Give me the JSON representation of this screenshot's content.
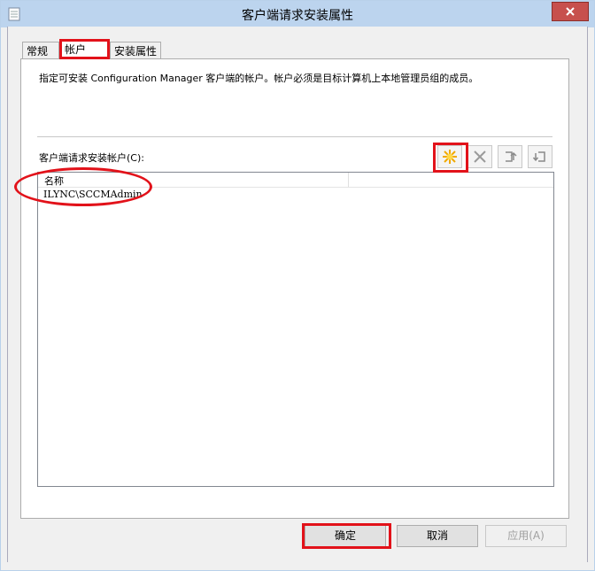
{
  "window": {
    "title": "客户端请求安装属性"
  },
  "tabs": [
    {
      "label": "常规"
    },
    {
      "label": "帐户"
    },
    {
      "label": "安装属性"
    }
  ],
  "panel": {
    "description": "指定可安装 Configuration Manager 客户端的帐户。帐户必须是目标计算机上本地管理员组的成员。",
    "list_label": "客户端请求安装帐户(C):",
    "toolbar": [
      {
        "icon": "new-star-icon"
      },
      {
        "icon": "delete-x-icon"
      },
      {
        "icon": "move-up-icon"
      },
      {
        "icon": "move-down-icon"
      }
    ],
    "columns": [
      "名称"
    ],
    "rows": [
      {
        "name": "ILYNC\\SCCMAdmin"
      }
    ]
  },
  "buttons": {
    "ok": "确定",
    "cancel": "取消",
    "apply": "应用(A)"
  },
  "colors": {
    "highlight": "#e2121a",
    "titlebar": "#bcd4ee",
    "close": "#c7504d"
  }
}
